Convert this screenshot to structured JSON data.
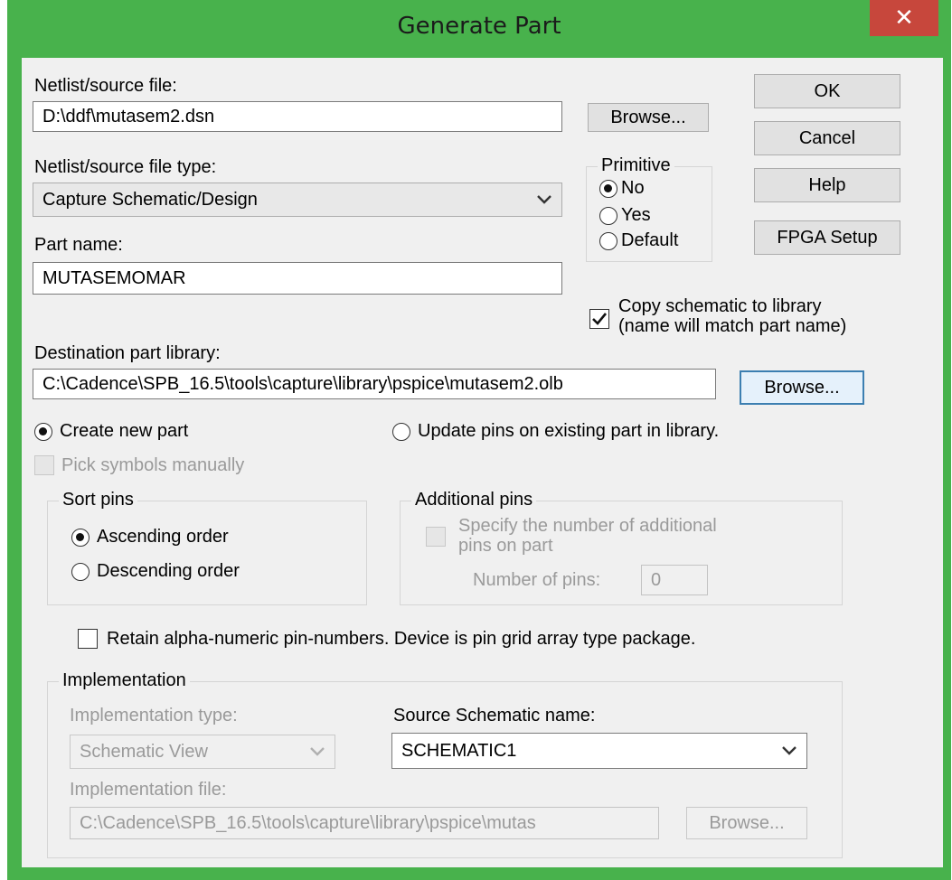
{
  "window": {
    "title": "Generate Part",
    "close_glyph": "✕"
  },
  "netlist": {
    "label": "Netlist/source file:",
    "value": "D:\\ddf\\mutasem2.dsn",
    "browse": "Browse..."
  },
  "filetype": {
    "label": "Netlist/source file type:",
    "selected": "Capture Schematic/Design"
  },
  "part_name": {
    "label": "Part name:",
    "value": "MUTASEMOMAR"
  },
  "primitive": {
    "title": "Primitive",
    "options": [
      "No",
      "Yes",
      "Default"
    ],
    "selected": "No"
  },
  "buttons": {
    "ok": "OK",
    "cancel": "Cancel",
    "help": "Help",
    "fpga": "FPGA Setup"
  },
  "copy_schematic": {
    "line1": "Copy schematic to library",
    "line2": "(name will match part name)",
    "checked": true
  },
  "destination": {
    "label": "Destination part library:",
    "value": "C:\\Cadence\\SPB_16.5\\tools\\capture\\library\\pspice\\mutasem2.olb",
    "browse": "Browse..."
  },
  "mode": {
    "create": "Create new part",
    "update": "Update pins on existing part in library.",
    "selected": "create"
  },
  "pick_symbols": "Pick symbols manually",
  "sort_pins": {
    "title": "Sort pins",
    "ascending": "Ascending order",
    "descending": "Descending order",
    "selected": "ascending"
  },
  "additional_pins": {
    "title": "Additional pins",
    "specify_line1": "Specify the number of additional",
    "specify_line2": "pins on part",
    "count_label": "Number of pins:",
    "count_value": "0"
  },
  "retain": "Retain alpha-numeric pin-numbers. Device is pin grid array type package.",
  "implementation": {
    "title": "Implementation",
    "type_label": "Implementation type:",
    "type_value": "Schematic View",
    "source_label": "Source Schematic name:",
    "source_value": "SCHEMATIC1",
    "file_label": "Implementation file:",
    "file_value": "C:\\Cadence\\SPB_16.5\\tools\\capture\\library\\pspice\\mutas",
    "browse": "Browse..."
  },
  "icons": [
    "close-icon",
    "chevron-down-icon",
    "checkmark-icon"
  ],
  "colors": {
    "titlebar": "#48b24c",
    "close": "#c7473c",
    "client": "#f0f0f0"
  }
}
